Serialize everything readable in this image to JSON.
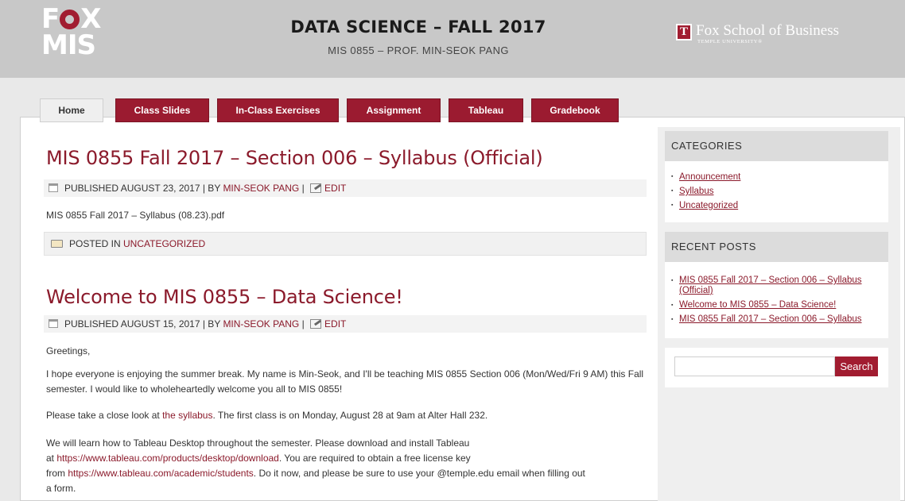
{
  "header": {
    "logo_line1_left": "F",
    "logo_line1_right": "X",
    "logo_line2": "MIS",
    "title": "DATA SCIENCE – FALL 2017",
    "subtitle": "MIS 0855 – PROF. MIN-SEOK PANG",
    "school_logo_mark": "T",
    "school_name": "Fox School of Business",
    "school_university": "TEMPLE UNIVERSITY®"
  },
  "nav": {
    "tabs": [
      {
        "label": "Home",
        "active": true
      },
      {
        "label": "Class Slides",
        "active": false
      },
      {
        "label": "In-Class Exercises",
        "active": false
      },
      {
        "label": "Assignment",
        "active": false
      },
      {
        "label": "Tableau",
        "active": false
      },
      {
        "label": "Gradebook",
        "active": false
      }
    ]
  },
  "posts": [
    {
      "title": "MIS 0855 Fall 2017 – Section 006 – Syllabus (Official)",
      "published": "PUBLISHED AUGUST 23, 2017 | BY ",
      "author": "MIN-SEOK PANG",
      "sep": " | ",
      "edit": "EDIT",
      "attachment": "MIS 0855 Fall 2017 – Syllabus (08.23).pdf",
      "posted_in": "POSTED IN ",
      "category": "UNCATEGORIZED"
    },
    {
      "title": "Welcome to MIS 0855 – Data Science!",
      "published": "PUBLISHED AUGUST 15, 2017 | BY ",
      "author": "MIN-SEOK PANG",
      "sep": " | ",
      "edit": "EDIT",
      "p1": "Greetings,",
      "p2": "I hope everyone is enjoying the summer break. My name is Min-Seok, and I'll be teaching MIS 0855 Section 006 (Mon/Wed/Fri 9 AM) this Fall semester. I would like to wholeheartedly welcome you all to MIS 0855!",
      "p3_a": "Please take a close look at ",
      "p3_link": "the syllabus",
      "p3_b": ". The first class is on Monday, August 28 at 9am at Alter Hall 232.",
      "p4_a": "We will learn how to Tableau Desktop throughout the semester. Please download and install Tableau",
      "p4_b": "at ",
      "p4_link1": "https://www.tableau.com/products/desktop/download",
      "p4_c": ". You are required to obtain a free license key",
      "p4_d": "from ",
      "p4_link2": "https://www.tableau.com/academic/students",
      "p4_e": ". Do it now, and please be sure to use your @temple.edu email when filling out",
      "p4_f": "a form."
    }
  ],
  "sidebar": {
    "categories_title": "CATEGORIES",
    "categories": [
      "Announcement",
      "Syllabus",
      "Uncategorized"
    ],
    "recent_title": "RECENT POSTS",
    "recent": [
      "MIS 0855 Fall 2017 – Section 006 – Syllabus (Official)",
      "Welcome to MIS 0855 – Data Science!",
      "MIS 0855 Fall 2017 – Section 006 – Syllabus"
    ],
    "search_button": "Search",
    "search_value": ""
  },
  "colors": {
    "brand": "#a11c30",
    "link": "#8b1a2b",
    "header_bg": "#c8c8c8"
  }
}
